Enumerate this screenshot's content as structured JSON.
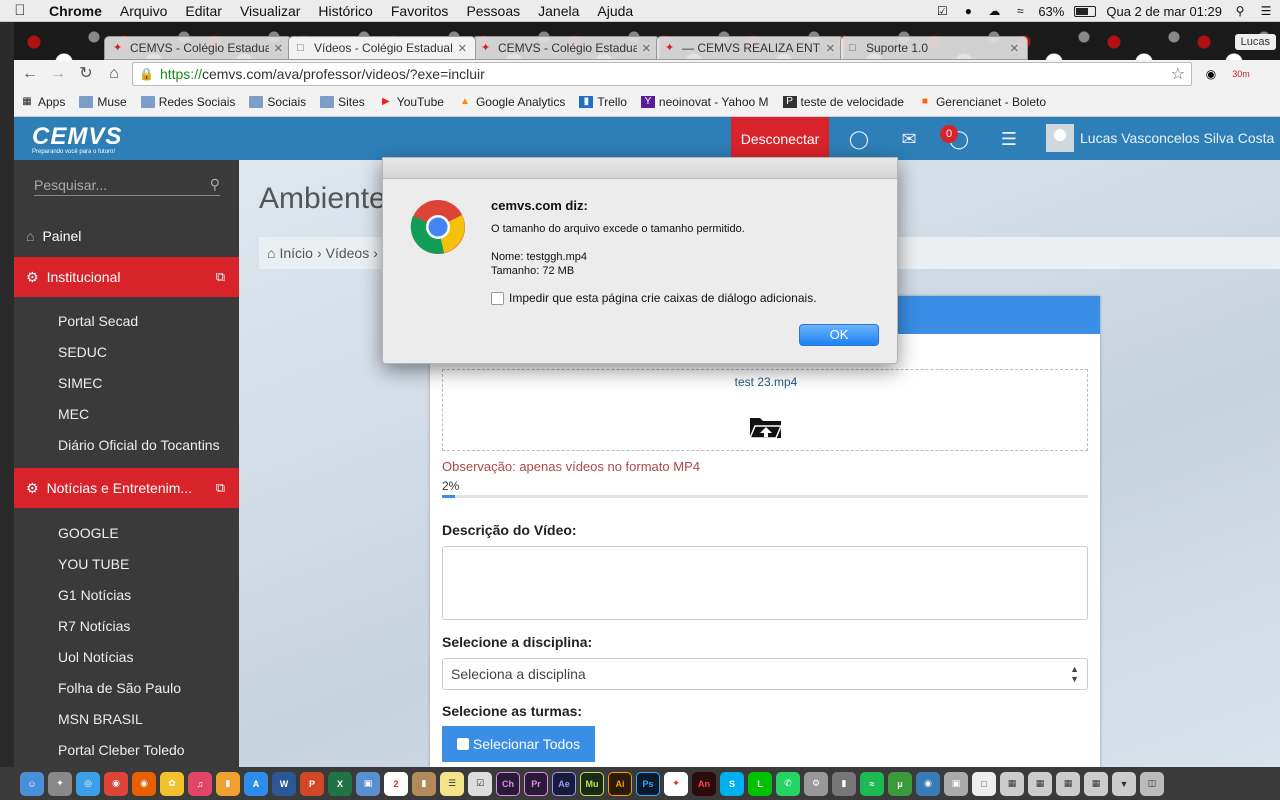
{
  "menubar": {
    "apple": "",
    "items": [
      "Chrome",
      "Arquivo",
      "Editar",
      "Visualizar",
      "Histórico",
      "Favoritos",
      "Pessoas",
      "Janela",
      "Ajuda"
    ],
    "battery": "63%",
    "datetime": "Qua 2 de mar  01:29"
  },
  "browser": {
    "tabs": [
      {
        "title": "CEMVS - Colégio Estadual"
      },
      {
        "title": "Vídeos - Colégio Estadual"
      },
      {
        "title": "CEMVS - Colégio Estadual"
      },
      {
        "title": "— CEMVS REALIZA ENTRE"
      },
      {
        "title": "Suporte 1.0"
      }
    ],
    "profile": "Lucas",
    "url_scheme": "https://",
    "url_rest": "cemvs.com/ava/professor/videos/?exe=incluir",
    "ext_badge": "30m",
    "bookmarks": [
      "Apps",
      "Muse",
      "Redes Sociais",
      "Sociais",
      "Sites",
      "YouTube",
      "Google Analytics",
      "Trello",
      "neoinovat - Yahoo M",
      "teste de velocidade",
      "Gerencianet - Boleto"
    ]
  },
  "site": {
    "logo": "CEMVS",
    "logo_tagline": "Preparando você para o futuro!",
    "disconnect": "Desconectar",
    "badge_count": "0",
    "user_name": "Lucas Vasconcelos Silva Costa",
    "search_placeholder": "Pesquisar...",
    "sidebar": {
      "painel": "Painel",
      "institucional": "Institucional",
      "inst_items": [
        "Portal Secad",
        "SEDUC",
        "SIMEC",
        "MEC",
        "Diário Oficial do Tocantins"
      ],
      "noticias": "Notícias e Entretenim...",
      "news_items": [
        "GOOGLE",
        "YOU TUBE",
        "G1 Notícias",
        "R7 Notícias",
        "Uol Notícias",
        "Folha de São Paulo",
        "MSN BRASIL",
        "Portal Cleber Toledo"
      ]
    },
    "page_title": "Ambiente",
    "breadcrumb": [
      "Início",
      "Vídeos"
    ],
    "upload": {
      "file_name": "test 23.mp4",
      "note": "Observação: apenas vídeos no formato MP4",
      "progress_label": "2%",
      "progress": 0.02,
      "desc_label": "Descrição do Vídeo:",
      "discipline_label": "Selecione a disciplina:",
      "discipline_value": "Seleciona a disciplina",
      "classes_label": "Selecione as turmas:",
      "select_all": "Selecionar Todos"
    }
  },
  "dialog": {
    "title": "cemvs.com diz:",
    "message": "O tamanho do arquivo excede o tamanho permitido.",
    "name_line": "Nome: testggh.mp4",
    "size_line": "Tamanho: 72 MB",
    "checkbox": "Impedir que esta página crie caixas de diálogo adicionais.",
    "ok": "OK"
  },
  "dock": [
    "Ch",
    "Pr",
    "Ae",
    "Mu",
    "Ai",
    "Ps"
  ],
  "colors": {
    "brand_blue": "#2e7fb8",
    "brand_red": "#d9232a",
    "accent_blue": "#3a8ee6"
  }
}
